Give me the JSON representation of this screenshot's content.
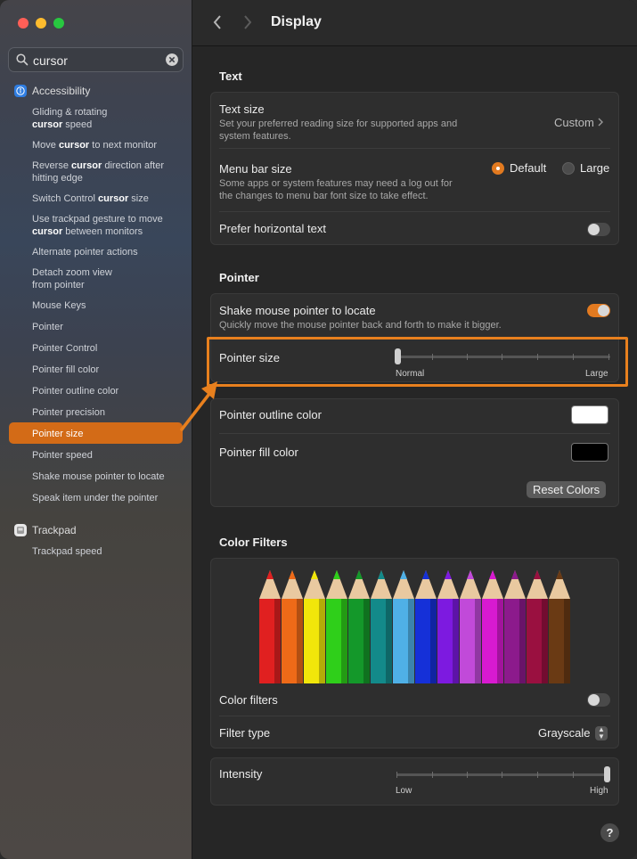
{
  "window": {
    "title": "Display"
  },
  "colors": {
    "accent": "#d36b17",
    "highlight": "#e8801e",
    "close": "#ff5f57",
    "minimize": "#febc2e",
    "zoom": "#28c840"
  },
  "search": {
    "value": "cursor",
    "icon": "magnifying-glass-icon",
    "clear_icon": "clear-icon"
  },
  "sidebar": {
    "accessibility_header": "Accessibility",
    "trackpad_header": "Trackpad",
    "items": [
      {
        "pre": "Gliding & rotating ",
        "match": "",
        "post": "",
        "line2_pre": "",
        "line2_match": "cursor",
        "line2_post": " speed"
      },
      {
        "pre": "Move ",
        "match": "cursor",
        "post": " to next monitor"
      },
      {
        "pre": "Reverse ",
        "match": "cursor",
        "post": " direction after",
        "line2_pre": "hitting edge",
        "line2_match": "",
        "line2_post": ""
      },
      {
        "pre": "Switch Control ",
        "match": "cursor",
        "post": " size"
      },
      {
        "pre": "Use trackpad gesture to move",
        "match": "",
        "post": "",
        "line2_pre": "",
        "line2_match": "cursor",
        "line2_post": " between monitors"
      },
      {
        "pre": "Alternate pointer actions",
        "match": "",
        "post": ""
      },
      {
        "pre": "Detach zoom view",
        "match": "",
        "post": "",
        "line2_pre": "from pointer",
        "line2_match": "",
        "line2_post": ""
      },
      {
        "pre": "Mouse Keys",
        "match": "",
        "post": ""
      },
      {
        "pre": "Pointer",
        "match": "",
        "post": ""
      },
      {
        "pre": "Pointer Control",
        "match": "",
        "post": ""
      },
      {
        "pre": "Pointer fill color",
        "match": "",
        "post": ""
      },
      {
        "pre": "Pointer outline color",
        "match": "",
        "post": ""
      },
      {
        "pre": "Pointer precision",
        "match": "",
        "post": ""
      },
      {
        "pre": "Pointer size",
        "match": "",
        "post": ""
      },
      {
        "pre": "Pointer speed",
        "match": "",
        "post": ""
      },
      {
        "pre": "Shake mouse pointer to locate",
        "match": "",
        "post": ""
      },
      {
        "pre": "Speak item under the pointer",
        "match": "",
        "post": ""
      }
    ],
    "trackpad_items": [
      "Trackpad speed"
    ]
  },
  "text_section": {
    "heading": "Text",
    "text_size_label": "Text size",
    "text_size_desc1": "Set your preferred reading size for supported apps and",
    "text_size_desc2": "system features.",
    "text_size_value": "Custom",
    "menubar_label": "Menu bar size",
    "menubar_desc1": "Some apps or system features may need a log out for",
    "menubar_desc2": "the changes to menu bar font size to take effect.",
    "menubar_default": "Default",
    "menubar_large": "Large",
    "menubar_selected": "Default",
    "prefer_horizontal_label": "Prefer horizontal text",
    "prefer_horizontal_on": false
  },
  "pointer_section": {
    "heading": "Pointer",
    "shake_label": "Shake mouse pointer to locate",
    "shake_desc": "Quickly move the mouse pointer back and forth to make it bigger.",
    "shake_on": true,
    "size_label": "Pointer size",
    "size_min_label": "Normal",
    "size_max_label": "Large",
    "size_value": 0,
    "outline_label": "Pointer outline color",
    "outline_color": "#ffffff",
    "fill_label": "Pointer fill color",
    "fill_color": "#000000",
    "reset_label": "Reset Colors"
  },
  "color_filters_section": {
    "heading": "Color Filters",
    "pencil_colors": [
      "#e02020",
      "#ee6a18",
      "#f1e60a",
      "#2fcf1a",
      "#14982a",
      "#138a8a",
      "#4fb0e6",
      "#1530d8",
      "#7d1ae0",
      "#c14ad9",
      "#d81ad0",
      "#8c1a8c",
      "#9a1040",
      "#6a3a14"
    ],
    "filters_label": "Color filters",
    "filters_on": false,
    "filter_type_label": "Filter type",
    "filter_type_value": "Grayscale",
    "intensity_label": "Intensity",
    "intensity_min_label": "Low",
    "intensity_max_label": "High",
    "intensity_value": 1
  },
  "help": "?"
}
